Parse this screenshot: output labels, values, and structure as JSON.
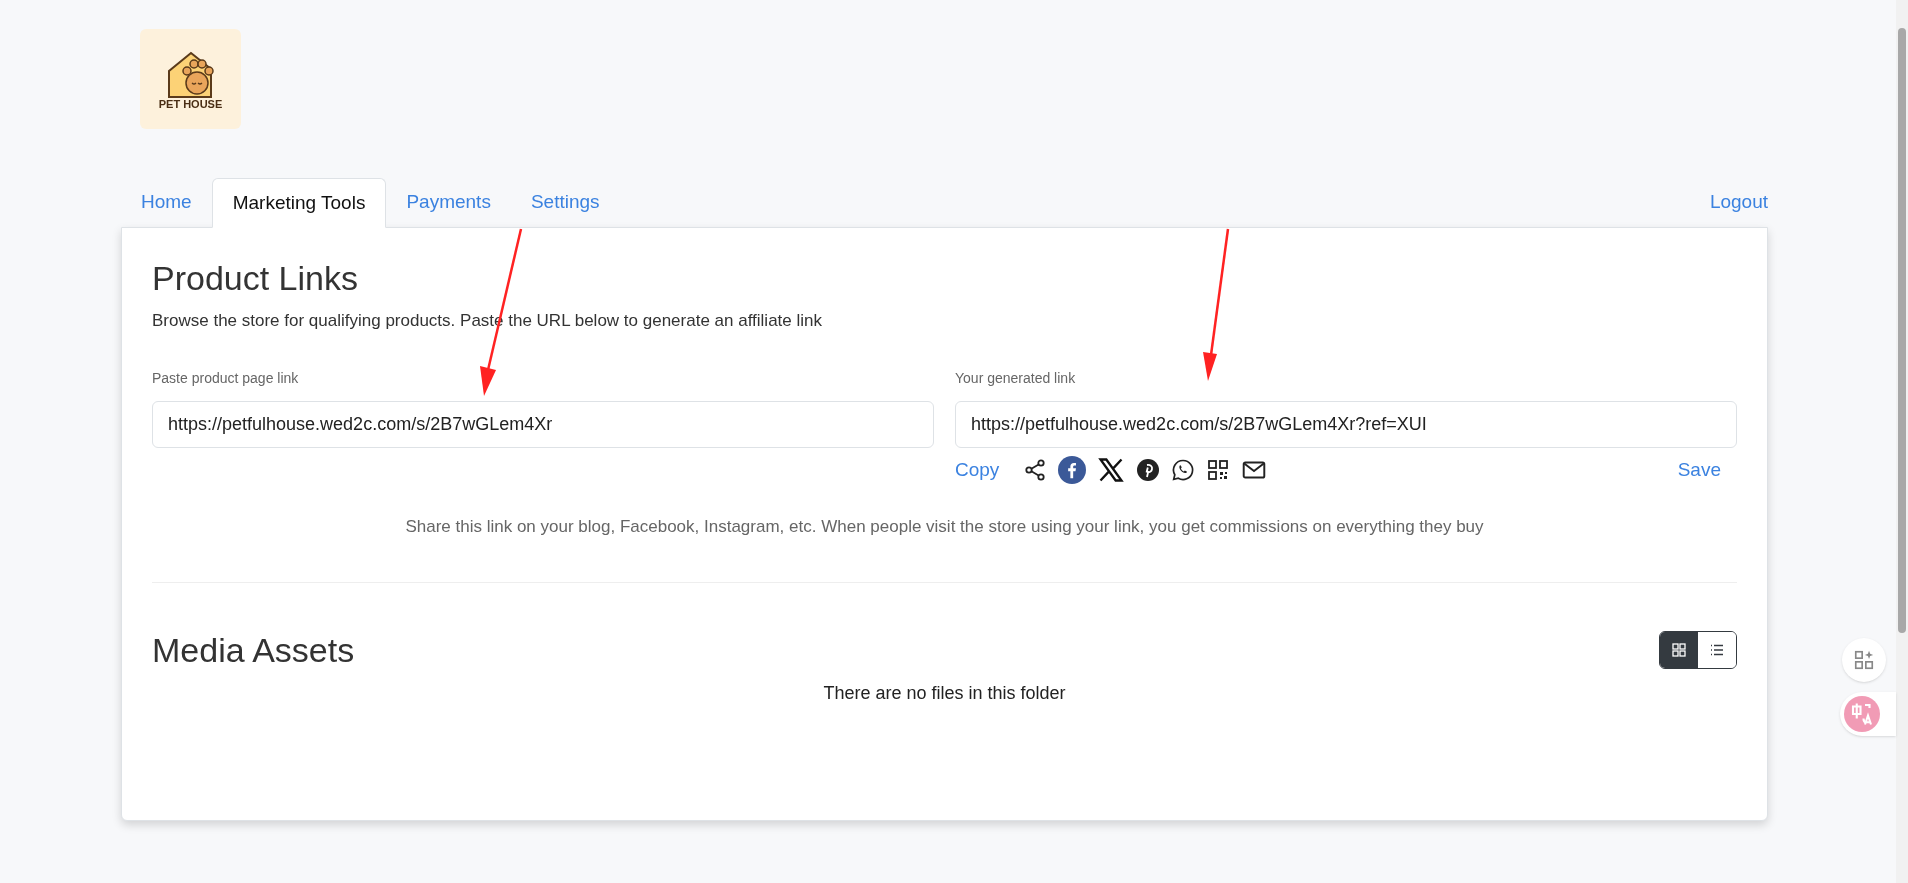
{
  "logo": {
    "text": "PET HOUSE"
  },
  "tabs": [
    {
      "label": "Home",
      "selected": false
    },
    {
      "label": "Marketing Tools",
      "selected": true
    },
    {
      "label": "Payments",
      "selected": false
    },
    {
      "label": "Settings",
      "selected": false
    }
  ],
  "logout": "Logout",
  "product_links": {
    "title": "Product Links",
    "description": "Browse the store for qualifying products. Paste the URL below to generate an affiliate link",
    "source_field": {
      "label": "Paste product page link",
      "value": "https://petfulhouse.wed2c.com/s/2B7wGLem4Xr"
    },
    "generated_field": {
      "label": "Your generated link",
      "value": "https://petfulhouse.wed2c.com/s/2B7wGLem4Xr?ref=XUI"
    },
    "copy": "Copy",
    "save": "Save",
    "share_note": "Share this link on your blog, Facebook, Instagram, etc. When people visit the store using your link, you get commissions on everything they buy"
  },
  "media_assets": {
    "title": "Media Assets",
    "empty_message": "There are no files in this folder",
    "view_toggle": [
      {
        "kind": "grid",
        "selected": true
      },
      {
        "kind": "list",
        "selected": false
      }
    ]
  }
}
